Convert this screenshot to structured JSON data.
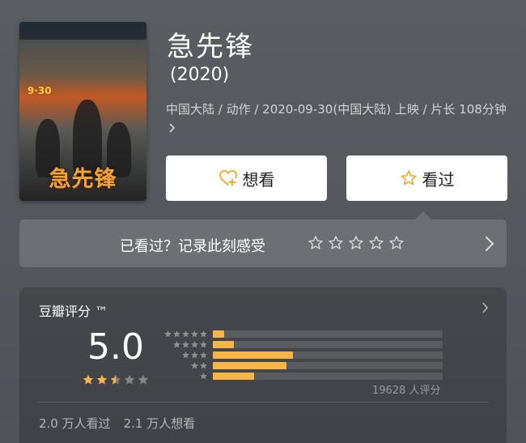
{
  "movie": {
    "title": "急先锋",
    "year": "(2020)",
    "meta": "中国大陆 / 动作 / 2020-09-30(中国大陆) 上映 / 片长 108分钟",
    "poster": {
      "title": "急先锋",
      "date": "9·30"
    }
  },
  "actions": {
    "want_label": "想看",
    "seen_label": "看过"
  },
  "record": {
    "prompt": "已看过？记录此刻感受",
    "stars": 5
  },
  "rating": {
    "header": "豆瓣评分 ™",
    "score": "5.0",
    "stars_filled": 2.5,
    "distribution": [
      {
        "stars": 5,
        "fraction": 0.05
      },
      {
        "stars": 4,
        "fraction": 0.09
      },
      {
        "stars": 3,
        "fraction": 0.35
      },
      {
        "stars": 2,
        "fraction": 0.32
      },
      {
        "stars": 1,
        "fraction": 0.18
      }
    ],
    "count_text": "19628 人评分",
    "watched": "2.0 万人看过",
    "wanted": "2.1 万人想看"
  },
  "colors": {
    "accent": "#f6b545",
    "background": "#55595e"
  }
}
